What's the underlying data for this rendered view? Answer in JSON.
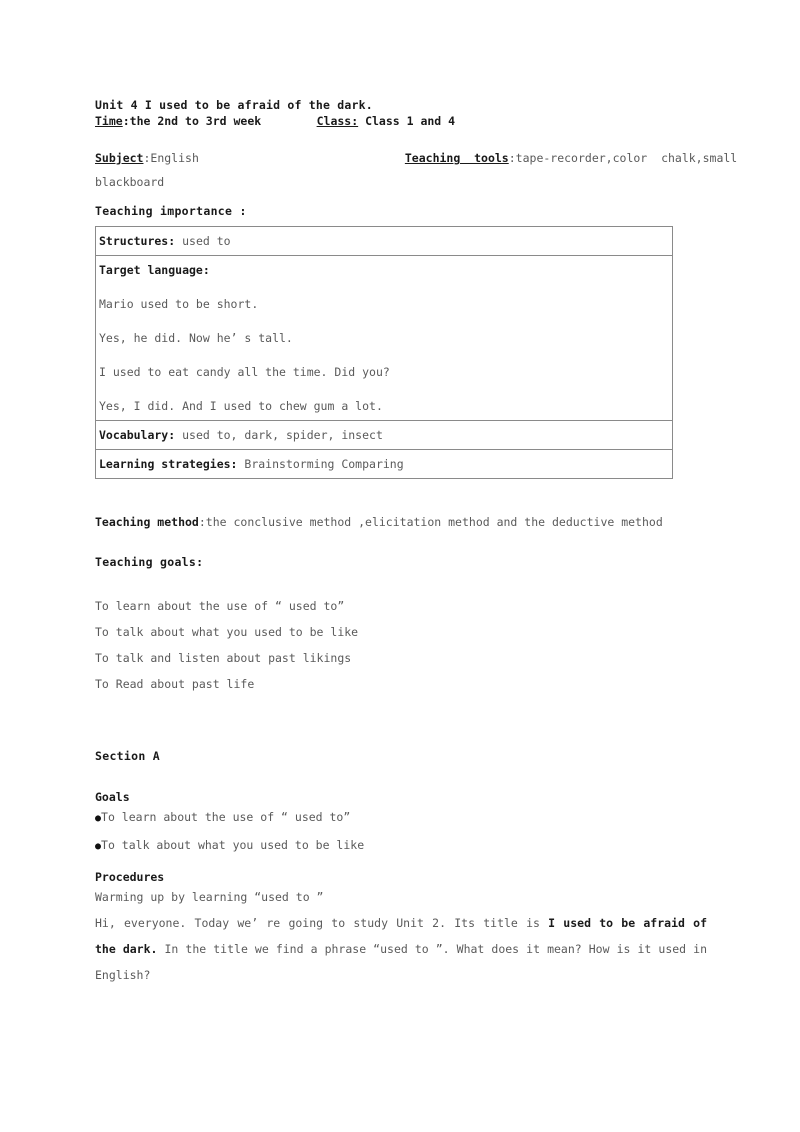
{
  "document": {
    "title": "Unit 4 I used to be afraid of the dark.",
    "header": {
      "time_label": "Time",
      "time_sep": ":",
      "time_value": "the 2nd to 3rd week",
      "class_label": "Class:",
      "class_value": " Class 1 and 4",
      "subject_label": "Subject",
      "subject_sep": ":",
      "subject_value": "English",
      "tools_label": "Teaching  tools",
      "tools_sep": ":",
      "tools_value": "tape-recorder,color  chalk,small",
      "tools_value_wrap": "blackboard"
    },
    "teaching_importance_heading": "Teaching importance :",
    "table": {
      "structures_label": "Structures:",
      "structures_value": " used to",
      "target_language_label": "Target language:",
      "target_language_lines": [
        "Mario used to be short.",
        "Yes, he did. Now he’ s tall.",
        "I used to eat candy all the time. Did you?",
        "Yes, I did. And I used to chew gum a lot."
      ],
      "vocabulary_label": "Vocabulary:",
      "vocabulary_value": " used to, dark, spider, insect",
      "strategies_label": "Learning strategies:",
      "strategies_value": " Brainstorming Comparing"
    },
    "teaching_method": {
      "label": "Teaching method",
      "sep": ":",
      "value": "the conclusive method ,elicitation method and the deductive method"
    },
    "teaching_goals": {
      "heading": "Teaching goals:",
      "items": [
        "To learn about the use of  “ used to”",
        "To talk about what you used to be like",
        "To talk and listen about past likings",
        "To Read about past life"
      ]
    },
    "section_a": {
      "heading": "Section A",
      "goals_heading": "Goals",
      "bullet": "●",
      "goals": [
        "To learn about the use of  “ used to”",
        "To talk about what you used to be like"
      ],
      "procedures_heading": "Procedures",
      "warming_line": "Warming up by learning  “used to ”",
      "paragraph": {
        "part1": "Hi, everyone. Today we’ re going to study Unit 2. Its title is ",
        "bold1": "I used to be afraid of the dark.",
        "part2": " In the title we find a phrase   “used to ”. What does it mean? How is it used in English?"
      }
    }
  }
}
